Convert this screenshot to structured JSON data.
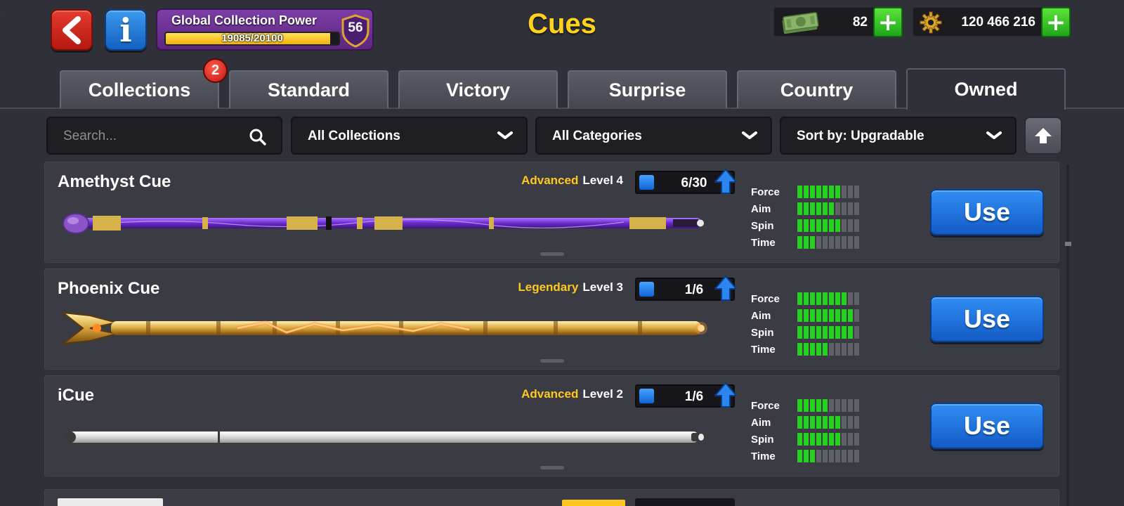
{
  "header": {
    "title": "Cues",
    "collection_power": {
      "label": "Global Collection Power",
      "current": "19085",
      "max": "20100",
      "fraction": 0.9495,
      "level": "56"
    },
    "cash": {
      "value": "82",
      "icon": "cash-icon",
      "add_label": "+"
    },
    "coins": {
      "value": "120 466 216",
      "icon": "coins-gear-icon",
      "add_label": "+"
    }
  },
  "tabs": [
    {
      "label": "Collections",
      "badge": "2"
    },
    {
      "label": "Standard"
    },
    {
      "label": "Victory"
    },
    {
      "label": "Surprise"
    },
    {
      "label": "Country"
    },
    {
      "label": "Owned",
      "active": true
    }
  ],
  "filters": {
    "search_placeholder": "Search...",
    "collections": "All Collections",
    "categories": "All Categories",
    "sort": "Sort by: Upgradable"
  },
  "stat_labels": {
    "force": "Force",
    "aim": "Aim",
    "spin": "Spin",
    "time": "Time"
  },
  "cues": [
    {
      "name": "Amethyst Cue",
      "rarity": "Advanced",
      "level": "Level 4",
      "progress": "6/30",
      "progress_fraction": 0.2,
      "stats": {
        "force": 7,
        "aim": 6,
        "spin": 7,
        "time": 3
      },
      "use_label": "Use",
      "style": "amethyst"
    },
    {
      "name": "Phoenix Cue",
      "rarity": "Legendary",
      "level": "Level 3",
      "progress": "1/6",
      "progress_fraction": 0.17,
      "stats": {
        "force": 8,
        "aim": 9,
        "spin": 9,
        "time": 5
      },
      "use_label": "Use",
      "style": "phoenix"
    },
    {
      "name": "iCue",
      "rarity": "Advanced",
      "level": "Level 2",
      "progress": "1/6",
      "progress_fraction": 0.17,
      "stats": {
        "force": 5,
        "aim": 7,
        "spin": 7,
        "time": 3
      },
      "use_label": "Use",
      "style": "white"
    }
  ],
  "stat_max": 10
}
